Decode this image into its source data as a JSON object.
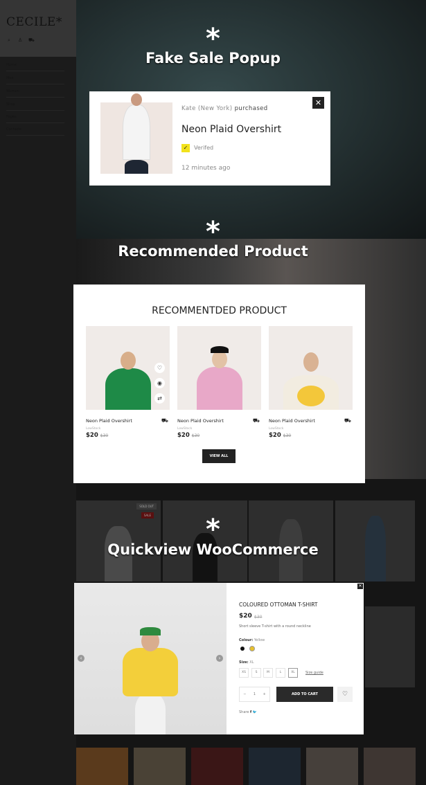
{
  "sidebar": {
    "logo": "CECILE*",
    "nav": [
      "Home",
      "Men",
      "Women",
      "Shop",
      "Pages",
      "Contacts"
    ],
    "icons": [
      "search-icon",
      "user-icon",
      "cart-icon"
    ]
  },
  "sections": {
    "fake_sale": "Fake Sale Popup",
    "recommended": "Recommended Product",
    "quickview": "Quickview WooCommerce",
    "asterisk": "*"
  },
  "popup": {
    "buyer": "Kate (New York)",
    "action": "purchased",
    "product": "Neon Plaid Overshirt",
    "verified": "Verifed",
    "time": "12 minutes ago",
    "close": "✕"
  },
  "recommended": {
    "title": "RECOMMENTDED PRODUCT",
    "view_all": "VIEW ALL",
    "products": [
      {
        "name": "Neon Plaid Overshirt",
        "stock": "LowStock",
        "price": "$20",
        "old_price": "$30",
        "color": "#1e8a47"
      },
      {
        "name": "Neon Plaid Overshirt",
        "stock": "LowStock",
        "price": "$20",
        "old_price": "$30",
        "color": "#e8a8c8"
      },
      {
        "name": "Neon Plaid Overshirt",
        "stock": "LowStock",
        "price": "$20",
        "old_price": "$30",
        "color": "#f3c73a"
      }
    ]
  },
  "grid": {
    "sold_out": "SOLD OUT",
    "sale": "SALE"
  },
  "quickview": {
    "title": "COLOURED OTTOMAN T-SHIRT",
    "price": "$20",
    "old_price": "$30",
    "description": "Short sleeve T-shirt with a round neckline",
    "colour_label": "Colour:",
    "colour_value": "Yellow",
    "colours": [
      "#111111",
      "#e8c02c"
    ],
    "size_label": "Size:",
    "size_value": "XL",
    "sizes": [
      "XS",
      "S",
      "M",
      "L",
      "XL"
    ],
    "size_guide": "Size guide",
    "quantity": "1",
    "add_to_cart": "ADD TO CART",
    "share": "Share",
    "close": "✕"
  }
}
